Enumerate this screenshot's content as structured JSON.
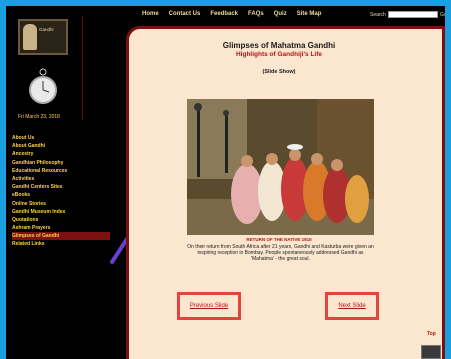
{
  "topnav": {
    "items": [
      "Home",
      "Contact Us",
      "Feedback",
      "FAQs",
      "Quiz",
      "Site Map"
    ],
    "search_label": "Search",
    "go_label": "Go"
  },
  "logo": {
    "text": "Gandhi"
  },
  "date": "Fri March 23, 2018",
  "sidebar": {
    "items": [
      "About Us",
      "About Gandhi",
      "Ancestry",
      "Gandhian Philosophy",
      "Educational Resources",
      "Activities",
      "Gandhi Centers Sites",
      "eBooks",
      "Online Stories",
      "Gandhi Museum Index",
      "Quotations",
      "Ashram Prayers",
      "Glimpses of Gandhi",
      "Related Links"
    ],
    "active_index": 12
  },
  "main": {
    "title": "Glimpses of Mahatma Gandhi",
    "subtitle": "Highlights of Gandhiji's Life",
    "slideshow": "(Slide Show)",
    "caption_title": "RETURN OF THE NATIVE 1915",
    "caption": "On their return from South Africa after 21 years, Gandhi and Kasturba were given an inspiring reception in Bombay. People spontaneously addressed Gandhi as 'Mahatma' - the great soul.",
    "prev_label": "Previous Slide",
    "next_label": "Next Slide",
    "top_label": "Top"
  },
  "colors": {
    "frame": "#1a9fe0",
    "accent": "#b31515",
    "highlight": "#e0443a",
    "page_bg": "#fbe6cf"
  }
}
